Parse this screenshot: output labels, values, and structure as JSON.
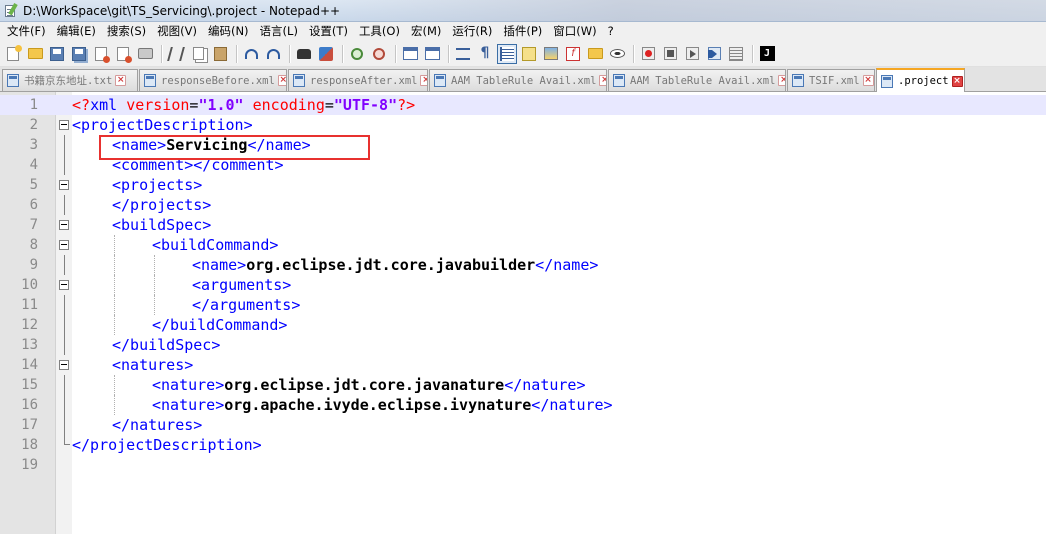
{
  "window": {
    "title": "D:\\WorkSpace\\git\\TS_Servicing\\.project - Notepad++"
  },
  "menu": [
    {
      "label": "文件(F)"
    },
    {
      "label": "编辑(E)"
    },
    {
      "label": "搜索(S)"
    },
    {
      "label": "视图(V)"
    },
    {
      "label": "编码(N)"
    },
    {
      "label": "语言(L)"
    },
    {
      "label": "设置(T)"
    },
    {
      "label": "工具(O)"
    },
    {
      "label": "宏(M)"
    },
    {
      "label": "运行(R)"
    },
    {
      "label": "插件(P)"
    },
    {
      "label": "窗口(W)"
    },
    {
      "label": "?"
    }
  ],
  "toolbar": {
    "icons": [
      "new-file-icon",
      "open-folder-icon",
      "save-icon",
      "save-all-icon",
      "close-file-icon",
      "close-all-icon",
      "print-icon",
      "cut-icon",
      "copy-icon",
      "paste-icon",
      "undo-icon",
      "redo-icon",
      "find-icon",
      "replace-icon",
      "zoom-in-icon",
      "zoom-out-icon",
      "sync-vertical-icon",
      "sync-horizontal-icon",
      "word-wrap-icon",
      "show-all-chars-icon",
      "indent-guide-icon",
      "user-language-icon",
      "document-map-icon",
      "function-list-icon",
      "folder-workspace-icon",
      "monitoring-icon",
      "macro-record-icon",
      "macro-stop-icon",
      "macro-play-icon",
      "macro-run-multiple-icon",
      "macro-save-icon",
      "jstool-icon"
    ],
    "jstool_label": "J"
  },
  "tabs": [
    {
      "label": "书籍京东地址.txt",
      "active": false
    },
    {
      "label": "responseBefore.xml",
      "active": false
    },
    {
      "label": "responseAfter.xml",
      "active": false
    },
    {
      "label": "AAM TableRule Avail.xml",
      "active": false
    },
    {
      "label": "AAM TableRule Avail.xml",
      "active": false
    },
    {
      "label": "TSIF.xml",
      "active": false
    },
    {
      "label": ".project",
      "active": true
    }
  ],
  "tab_close_glyph": "×",
  "editor": {
    "line_numbers": [
      "1",
      "2",
      "3",
      "4",
      "5",
      "6",
      "7",
      "8",
      "9",
      "10",
      "11",
      "12",
      "13",
      "14",
      "15",
      "16",
      "17",
      "18",
      "19"
    ],
    "lines": {
      "l1": {
        "open": "<?",
        "tag": "xml",
        "sp1": " ",
        "attr1": "version",
        "eq1": "=",
        "val1": "\"1.0\"",
        "sp2": " ",
        "attr2": "encoding",
        "eq2": "=",
        "val2": "\"UTF-8\"",
        "close": "?>"
      },
      "l2": {
        "tag": "<projectDescription>"
      },
      "l3": {
        "open": "<name>",
        "text": "Servicing",
        "close": "</name>"
      },
      "l4": {
        "open": "<comment>",
        "close": "</comment>"
      },
      "l5": {
        "tag": "<projects>"
      },
      "l6": {
        "tag": "</projects>"
      },
      "l7": {
        "tag": "<buildSpec>"
      },
      "l8": {
        "tag": "<buildCommand>"
      },
      "l9": {
        "open": "<name>",
        "text": "org.eclipse.jdt.core.javabuilder",
        "close": "</name>"
      },
      "l10": {
        "tag": "<arguments>"
      },
      "l11": {
        "tag": "</arguments>"
      },
      "l12": {
        "tag": "</buildCommand>"
      },
      "l13": {
        "tag": "</buildSpec>"
      },
      "l14": {
        "tag": "<natures>"
      },
      "l15": {
        "open": "<nature>",
        "text": "org.eclipse.jdt.core.javanature",
        "close": "</nature>"
      },
      "l16": {
        "open": "<nature>",
        "text": "org.apache.ivyde.eclipse.ivynature",
        "close": "</nature>"
      },
      "l17": {
        "tag": "</natures>"
      },
      "l18": {
        "tag": "</projectDescription>"
      }
    }
  },
  "colors": {
    "tag": "#0000ff",
    "attribute": "#ff0000",
    "value": "#8000ff",
    "current_line": "#e8e8ff",
    "active_tab_accent": "#f5a623",
    "annotation_box": "#e8312f"
  }
}
